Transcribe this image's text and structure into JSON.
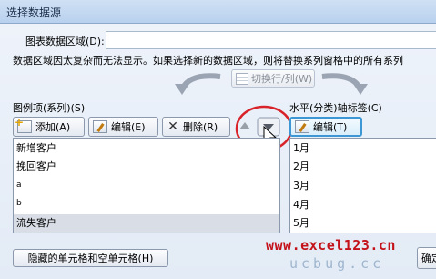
{
  "window": {
    "title": "选择数据源"
  },
  "data_range": {
    "label": "图表数据区域(D):",
    "value": ""
  },
  "message": "数据区域因太复杂而无法显示。如果选择新的数据区域，则将替换系列窗格中的所有系列",
  "switch_button": {
    "label": "切换行/列(W)"
  },
  "legend_panel": {
    "label": "图例项(系列)(S)",
    "add_label": "添加(A)",
    "edit_label": "编辑(E)",
    "delete_label": "删除(R)",
    "items": [
      "新增客户",
      "挽回客户",
      "a",
      "b",
      "流失客户"
    ]
  },
  "axis_panel": {
    "label": "水平(分类)轴标签(C)",
    "edit_label": "编辑(T)",
    "items": [
      "1月",
      "2月",
      "3月",
      "4月",
      "5月"
    ]
  },
  "hidden_cells_button": {
    "label": "隐藏的单元格和空单元格(H)"
  },
  "confirm_button": {
    "label": "确定"
  },
  "watermark": {
    "primary": "www.excel123.cn",
    "secondary": "ucbug.cc"
  },
  "colors": {
    "highlight_circle": "#d8232a",
    "selected_row": "#d9dee6",
    "title_bar": "#c3d8f1"
  }
}
